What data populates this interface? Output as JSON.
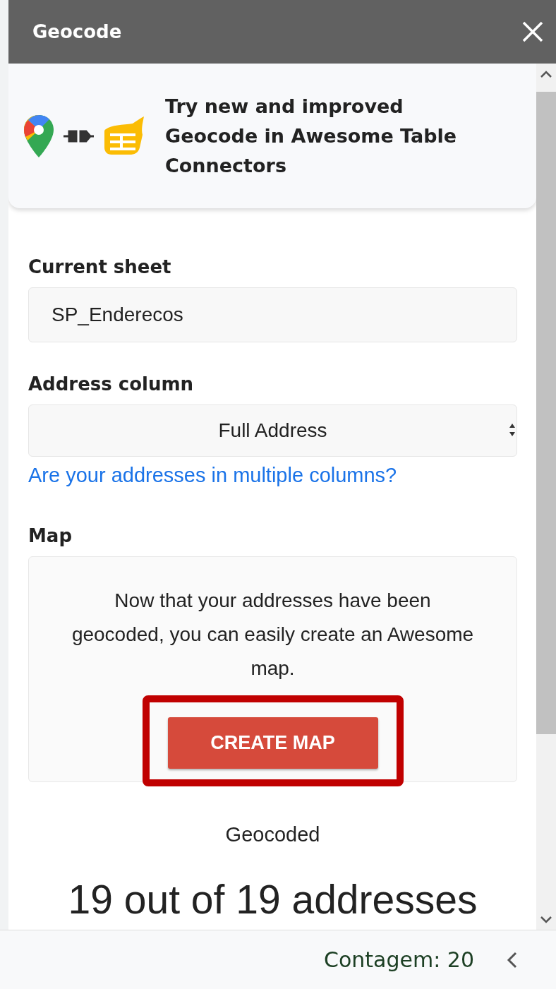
{
  "window": {
    "title": "Geocode"
  },
  "promo": {
    "text": "Try new and improved Geocode in Awesome Table Connectors"
  },
  "current_sheet": {
    "label": "Current sheet",
    "value": "SP_Enderecos"
  },
  "address_column": {
    "label": "Address column",
    "value": "Full Address",
    "link": "Are your addresses in multiple columns?"
  },
  "map": {
    "label": "Map",
    "text": "Now that your addresses have been geocoded, you can easily create an Awesome map.",
    "button": "CREATE MAP",
    "highlighted": true
  },
  "result": {
    "label": "Geocoded",
    "value": "19 out of 19 addresses"
  },
  "status_bar": {
    "count": "Contagem: 20"
  }
}
